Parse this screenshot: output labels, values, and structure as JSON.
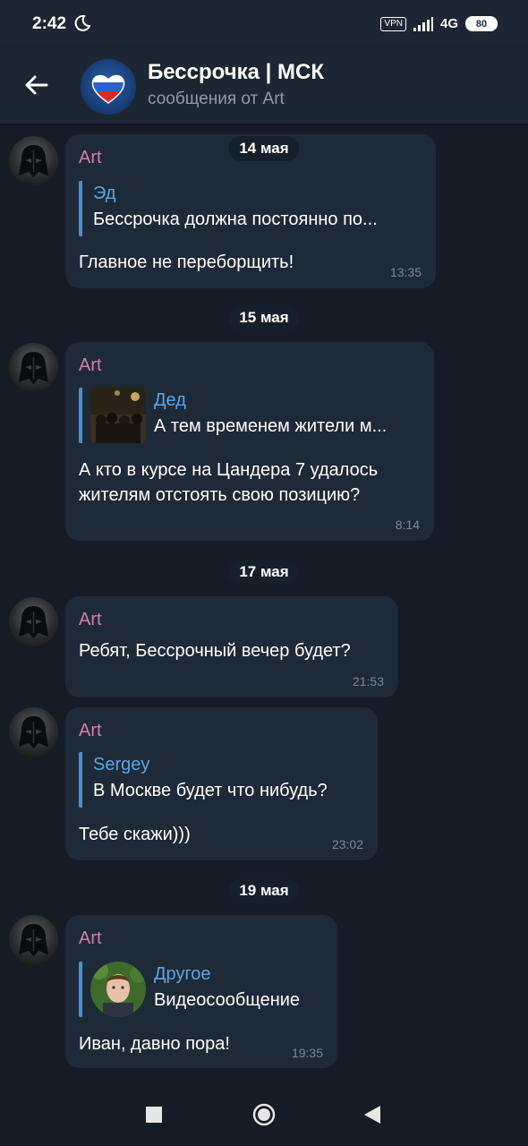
{
  "status_bar": {
    "time": "2:42",
    "vpn": "VPN",
    "network": "4G",
    "battery": "80",
    "icons": [
      "moon-icon",
      "signal-icon"
    ]
  },
  "header": {
    "title": "Бессрочка | МСК",
    "subtitle": "сообщения от Art",
    "icons": [
      "back-arrow-icon",
      "heart-flag-avatar"
    ]
  },
  "messages": [
    {
      "date": "14 мая",
      "sender": "Art",
      "reply_name": "Эд",
      "reply_text": "Бессрочка должна постоянно по...",
      "text": "Главное не переборщить!",
      "time": "13:35"
    },
    {
      "date": "15 мая",
      "sender": "Art",
      "reply_name": "Дед",
      "reply_text": "А тем временем жители м...",
      "text_line1": "А кто в курсе на Цандера 7 удалось",
      "text_line2": "жителям отстоять свою позицию?",
      "time": "8:14"
    },
    {
      "date": "17 мая",
      "sender": "Art",
      "text": "Ребят, Бессрочный вечер будет?",
      "time": "21:53"
    },
    {
      "sender": "Art",
      "reply_name": "Sergey",
      "reply_text": "В Москве будет что нибудь?",
      "text": "Тебе скажи)))",
      "time": "23:02"
    },
    {
      "date": "19 мая",
      "sender": "Art",
      "reply_name": "Другое",
      "reply_text": "Видеосообщение",
      "text": "Иван, давно пора!",
      "time": "19:35"
    }
  ],
  "nav": {
    "icons": [
      "recents-square-icon",
      "home-circle-icon",
      "back-triangle-icon"
    ]
  },
  "colors": {
    "background": "#151c26",
    "header": "#1d2733",
    "bubble": "#1e2a38",
    "sender": "#d77fa8",
    "reply_name": "#5ea4e6",
    "reply_bar": "#4d8ed0",
    "time": "#7b8896"
  }
}
